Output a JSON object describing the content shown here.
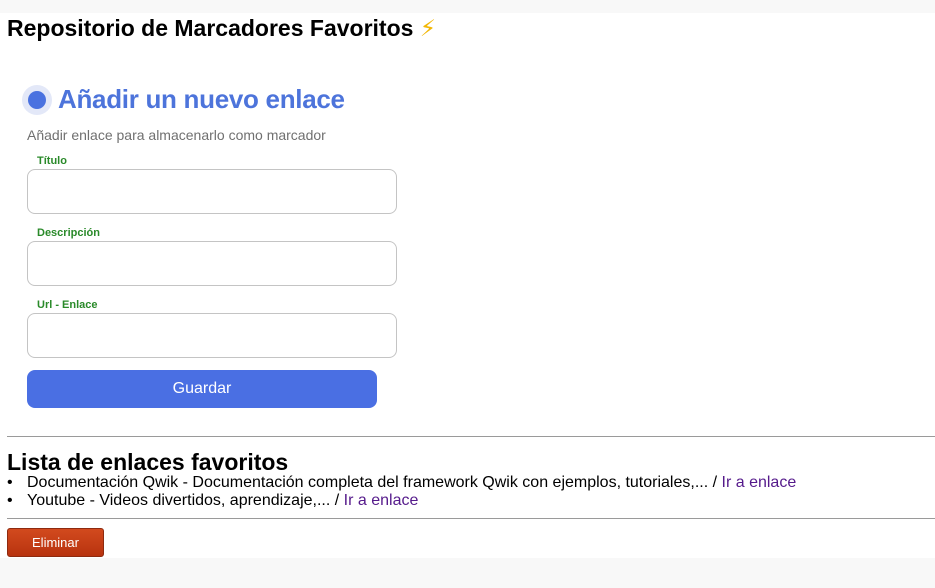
{
  "header": {
    "title": "Repositorio de Marcadores Favoritos",
    "emoji": "⚡"
  },
  "form": {
    "title": "Añadir un nuevo enlace",
    "subtitle": "Añadir enlace para almacenarlo como marcador",
    "fields": [
      {
        "label": "Título",
        "value": "",
        "placeholder": ""
      },
      {
        "label": "Descripción",
        "value": "",
        "placeholder": ""
      },
      {
        "label": "Url - Enlace",
        "value": "",
        "placeholder": ""
      }
    ],
    "submit_label": "Guardar"
  },
  "list": {
    "title": "Lista de enlaces favoritos",
    "bullet": "•",
    "items": [
      {
        "text": "Documentación Qwik - Documentación completa del framework Qwik con ejemplos, tutoriales,... /",
        "link_label": "Ir a enlace"
      },
      {
        "text": "Youtube - Videos divertidos, aprendizaje,... /",
        "link_label": "Ir a enlace"
      }
    ],
    "delete_label": "Eliminar"
  },
  "colors": {
    "accent": "#4a6fe3",
    "label_green": "#2a8a2a",
    "delete_red": "#c23e14",
    "visited_link": "#551a8b"
  }
}
